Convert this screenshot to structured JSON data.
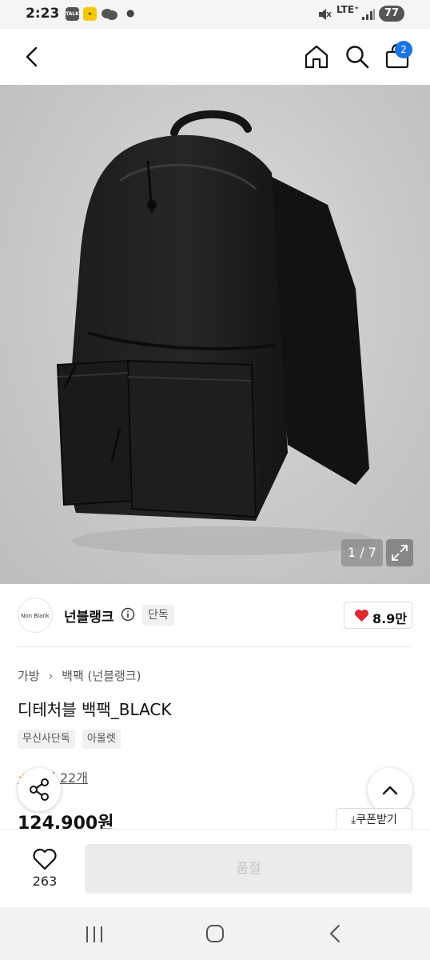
{
  "status_bar": {
    "time": "2:23",
    "talk_label": "TALK",
    "network": "LTE⁺",
    "battery": "77"
  },
  "header": {
    "cart_count": "2",
    "icons": [
      "back-icon",
      "home-icon",
      "search-icon",
      "shopping-bag-icon"
    ]
  },
  "gallery": {
    "counter": "1 / 7"
  },
  "brand": {
    "logo_text": "Non Blank",
    "name": "넌블랭크",
    "exclusive_tag": "단독",
    "like_count": "8.9만"
  },
  "product": {
    "breadcrumb": [
      "가방",
      "백팩 (넌블랭크)"
    ],
    "title": "디테처블 백팩_BLACK",
    "tags": [
      "무신사단독",
      "아울렛"
    ],
    "review_link": "후기 22개",
    "price": "124,900원",
    "coupon_label": "쿠폰받기"
  },
  "bottom_bar": {
    "wish_count": "263",
    "buy_button_label": "품절"
  },
  "colors": {
    "accent_blue": "#1a73e8",
    "heart_red": "#e0262f",
    "soldout_bg": "#ebebeb"
  }
}
